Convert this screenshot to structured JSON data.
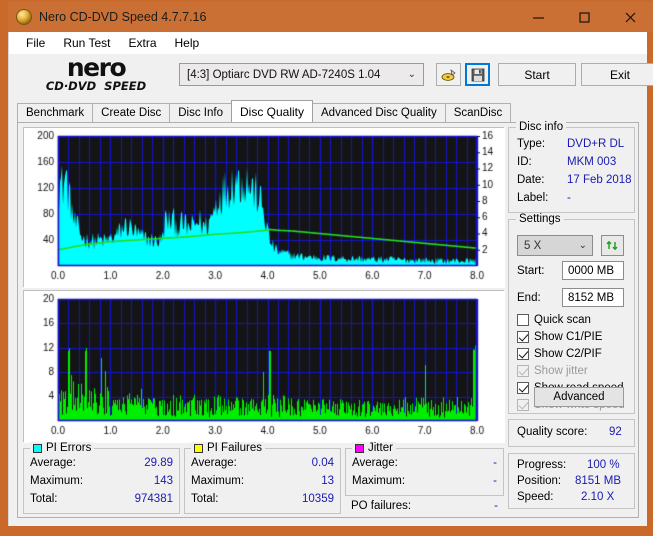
{
  "window": {
    "title": "Nero CD-DVD Speed 4.7.7.16",
    "icon": "nero-disc-icon",
    "minimize": "—",
    "maximize": "□",
    "close": "✕",
    "titlebar_color": "#cb7034"
  },
  "menu": [
    {
      "label": "File"
    },
    {
      "label": "Run Test"
    },
    {
      "label": "Extra"
    },
    {
      "label": "Help"
    }
  ],
  "logo": {
    "brand": "nero",
    "product": "CD·DVD  SPEED"
  },
  "toolbar": {
    "drive_value": "[4:3]   Optiarc DVD RW AD-7240S 1.04",
    "drive_caret": "⌄",
    "eject_icon": "eject-disc-icon",
    "save_icon": "floppy-save-icon",
    "start_label": "Start",
    "exit_label": "Exit"
  },
  "tabs": [
    {
      "label": "Benchmark",
      "active": false
    },
    {
      "label": "Create Disc",
      "active": false
    },
    {
      "label": "Disc Info",
      "active": false
    },
    {
      "label": "Disc Quality",
      "active": true
    },
    {
      "label": "Advanced Disc Quality",
      "active": false
    },
    {
      "label": "ScanDisc",
      "active": false
    }
  ],
  "disc_info": {
    "title": "Disc info",
    "type_label": "Type:",
    "type_value": "DVD+R DL",
    "id_label": "ID:",
    "id_value": "MKM 003",
    "date_label": "Date:",
    "date_value": "17 Feb 2018",
    "label_label": "Label:",
    "label_value": "-"
  },
  "settings": {
    "title": "Settings",
    "speed_value": "5 X",
    "speed_caret": "⌄",
    "refresh_icon": "refresh-arrows-icon",
    "start_label": "Start:",
    "start_value": "0000 MB",
    "end_label": "End:",
    "end_value": "8152 MB",
    "checkboxes": [
      {
        "label": "Quick scan",
        "checked": false,
        "disabled": false
      },
      {
        "label": "Show C1/PIE",
        "checked": true,
        "disabled": false
      },
      {
        "label": "Show C2/PIF",
        "checked": true,
        "disabled": false
      },
      {
        "label": "Show jitter",
        "checked": true,
        "disabled": true
      },
      {
        "label": "Show read speed",
        "checked": true,
        "disabled": false
      },
      {
        "label": "Show write speed",
        "checked": true,
        "disabled": true
      }
    ],
    "advanced_label": "Advanced"
  },
  "quality": {
    "label": "Quality score:",
    "value": "92"
  },
  "progress": {
    "progress_label": "Progress:",
    "progress_value": "100 %",
    "position_label": "Position:",
    "position_value": "8151 MB",
    "speed_label": "Speed:",
    "speed_value": "2.10 X"
  },
  "stats": {
    "pi_errors": {
      "title": "PI Errors",
      "color": "#00ffff",
      "average_label": "Average:",
      "average_value": "29.89",
      "maximum_label": "Maximum:",
      "maximum_value": "143",
      "total_label": "Total:",
      "total_value": "974381"
    },
    "pi_failures": {
      "title": "PI Failures",
      "color": "#ffff00",
      "average_label": "Average:",
      "average_value": "0.04",
      "maximum_label": "Maximum:",
      "maximum_value": "13",
      "total_label": "Total:",
      "total_value": "10359"
    },
    "jitter": {
      "title": "Jitter",
      "color": "#ff00ff",
      "average_label": "Average:",
      "average_value": "-",
      "maximum_label": "Maximum:",
      "maximum_value": "-",
      "po_label": "PO failures:",
      "po_value": "-"
    }
  },
  "chart_data": [
    {
      "type": "area",
      "name": "pi-errors-chart",
      "title": "",
      "xlabel": "",
      "ylabel": "PI Errors",
      "x_ticks": [
        "0.0",
        "1.0",
        "2.0",
        "3.0",
        "4.0",
        "5.0",
        "6.0",
        "7.0",
        "8.0"
      ],
      "xlim": [
        0,
        8
      ],
      "y_ticks": [
        "40",
        "80",
        "120",
        "160",
        "200"
      ],
      "ylim": [
        0,
        200
      ],
      "y2_ticks": [
        "2",
        "4",
        "6",
        "8",
        "10",
        "12",
        "14",
        "16"
      ],
      "y2lim": [
        0,
        16
      ],
      "grid": true,
      "plot_bg": "#141414",
      "grid_color": "#1414c8",
      "series": [
        {
          "name": "PI Errors",
          "color": "#00ffff",
          "kind": "area",
          "x": [
            0.0,
            0.05,
            0.1,
            0.15,
            0.2,
            0.25,
            0.3,
            0.35,
            0.4,
            0.45,
            0.5,
            0.6,
            0.7,
            0.8,
            0.9,
            1.0,
            1.1,
            1.2,
            1.3,
            1.4,
            1.5,
            1.6,
            1.7,
            1.8,
            1.9,
            2.0,
            2.05,
            2.1,
            2.2,
            2.3,
            2.4,
            2.5,
            2.6,
            2.7,
            2.8,
            2.9,
            3.0,
            3.1,
            3.2,
            3.3,
            3.4,
            3.5,
            3.6,
            3.7,
            3.8,
            3.9,
            4.0,
            4.05,
            4.1,
            4.2,
            4.3,
            4.4,
            4.5,
            4.6,
            4.8,
            5.0,
            5.2,
            5.4,
            5.6,
            5.8,
            6.0,
            6.2,
            6.4,
            6.6,
            6.8,
            7.0,
            7.2,
            7.4,
            7.6,
            7.8,
            8.0
          ],
          "y": [
            118,
            128,
            122,
            140,
            110,
            95,
            70,
            62,
            55,
            45,
            42,
            40,
            38,
            40,
            38,
            42,
            45,
            55,
            62,
            58,
            50,
            45,
            42,
            40,
            38,
            40,
            72,
            68,
            70,
            62,
            65,
            58,
            62,
            70,
            60,
            68,
            90,
            110,
            118,
            125,
            135,
            128,
            132,
            120,
            110,
            95,
            60,
            40,
            32,
            22,
            20,
            18,
            16,
            15,
            14,
            13,
            12,
            12,
            11,
            11,
            10,
            10,
            10,
            9,
            9,
            9,
            8,
            8,
            8,
            8,
            8
          ]
        },
        {
          "name": "Read speed",
          "color": "#22dd22",
          "kind": "line",
          "axis": "y2",
          "x": [
            0.0,
            0.5,
            1.0,
            1.5,
            2.0,
            2.5,
            3.0,
            3.5,
            4.0,
            4.05,
            4.2,
            4.5,
            5.0,
            5.5,
            6.0,
            6.5,
            7.0,
            7.5,
            8.0
          ],
          "y": [
            2.0,
            2.6,
            3.0,
            3.2,
            3.4,
            3.6,
            3.9,
            4.1,
            4.4,
            4.5,
            4.4,
            4.3,
            4.0,
            3.7,
            3.4,
            3.1,
            2.8,
            2.5,
            2.2
          ]
        }
      ]
    },
    {
      "type": "bar",
      "name": "pi-failures-chart",
      "title": "",
      "xlabel": "",
      "ylabel": "PI Failures",
      "x_ticks": [
        "0.0",
        "1.0",
        "2.0",
        "3.0",
        "4.0",
        "5.0",
        "6.0",
        "7.0",
        "8.0"
      ],
      "xlim": [
        0,
        8
      ],
      "y_ticks": [
        "4",
        "8",
        "12",
        "16",
        "20"
      ],
      "ylim": [
        0,
        20
      ],
      "grid": true,
      "plot_bg": "#141414",
      "grid_color": "#1414c8",
      "series": [
        {
          "name": "PI Failures",
          "color": "#00ee00",
          "kind": "bar",
          "note": "dense per-MB spikes, typical magnitude 1-8, occasional peaks to 11-13 near 0.2, 0.5, 4.05 and 8.0"
        }
      ]
    }
  ]
}
